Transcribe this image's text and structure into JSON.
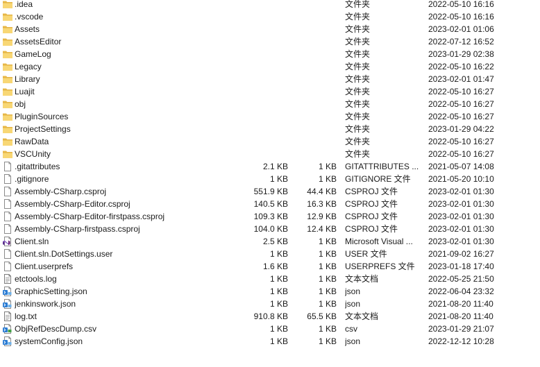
{
  "files": [
    {
      "name": ".idea",
      "size": "",
      "compressed": "",
      "type": "文件夹",
      "date": "2022-05-10 16:16",
      "icon": "folder-icon"
    },
    {
      "name": ".vscode",
      "size": "",
      "compressed": "",
      "type": "文件夹",
      "date": "2022-05-10 16:16",
      "icon": "folder-icon"
    },
    {
      "name": "Assets",
      "size": "",
      "compressed": "",
      "type": "文件夹",
      "date": "2023-02-01 01:06",
      "icon": "folder-icon"
    },
    {
      "name": "AssetsEditor",
      "size": "",
      "compressed": "",
      "type": "文件夹",
      "date": "2022-07-12 16:52",
      "icon": "folder-icon"
    },
    {
      "name": "GameLog",
      "size": "",
      "compressed": "",
      "type": "文件夹",
      "date": "2023-01-29 02:38",
      "icon": "folder-icon"
    },
    {
      "name": "Legacy",
      "size": "",
      "compressed": "",
      "type": "文件夹",
      "date": "2022-05-10 16:22",
      "icon": "folder-icon"
    },
    {
      "name": "Library",
      "size": "",
      "compressed": "",
      "type": "文件夹",
      "date": "2023-02-01 01:47",
      "icon": "folder-icon"
    },
    {
      "name": "Luajit",
      "size": "",
      "compressed": "",
      "type": "文件夹",
      "date": "2022-05-10 16:27",
      "icon": "folder-icon"
    },
    {
      "name": "obj",
      "size": "",
      "compressed": "",
      "type": "文件夹",
      "date": "2022-05-10 16:27",
      "icon": "folder-icon"
    },
    {
      "name": "PluginSources",
      "size": "",
      "compressed": "",
      "type": "文件夹",
      "date": "2022-05-10 16:27",
      "icon": "folder-icon"
    },
    {
      "name": "ProjectSettings",
      "size": "",
      "compressed": "",
      "type": "文件夹",
      "date": "2023-01-29 04:22",
      "icon": "folder-icon"
    },
    {
      "name": "RawData",
      "size": "",
      "compressed": "",
      "type": "文件夹",
      "date": "2022-05-10 16:27",
      "icon": "folder-icon"
    },
    {
      "name": "VSCUnity",
      "size": "",
      "compressed": "",
      "type": "文件夹",
      "date": "2022-05-10 16:27",
      "icon": "folder-icon"
    },
    {
      "name": ".gitattributes",
      "size": "2.1 KB",
      "compressed": "1 KB",
      "type": "GITATTRIBUTES ...",
      "date": "2021-05-07 14:08",
      "icon": "file-icon"
    },
    {
      "name": ".gitignore",
      "size": "1 KB",
      "compressed": "1 KB",
      "type": "GITIGNORE 文件",
      "date": "2021-05-20 10:10",
      "icon": "file-icon"
    },
    {
      "name": "Assembly-CSharp.csproj",
      "size": "551.9 KB",
      "compressed": "44.4 KB",
      "type": "CSPROJ 文件",
      "date": "2023-02-01 01:30",
      "icon": "file-icon"
    },
    {
      "name": "Assembly-CSharp-Editor.csproj",
      "size": "140.5 KB",
      "compressed": "16.3 KB",
      "type": "CSPROJ 文件",
      "date": "2023-02-01 01:30",
      "icon": "file-icon"
    },
    {
      "name": "Assembly-CSharp-Editor-firstpass.csproj",
      "size": "109.3 KB",
      "compressed": "12.9 KB",
      "type": "CSPROJ 文件",
      "date": "2023-02-01 01:30",
      "icon": "file-icon"
    },
    {
      "name": "Assembly-CSharp-firstpass.csproj",
      "size": "104.0 KB",
      "compressed": "12.4 KB",
      "type": "CSPROJ 文件",
      "date": "2023-02-01 01:30",
      "icon": "file-icon"
    },
    {
      "name": "Client.sln",
      "size": "2.5 KB",
      "compressed": "1 KB",
      "type": "Microsoft Visual ...",
      "date": "2023-02-01 01:30",
      "icon": "visual-studio-icon"
    },
    {
      "name": "Client.sln.DotSettings.user",
      "size": "1 KB",
      "compressed": "1 KB",
      "type": "USER 文件",
      "date": "2021-09-02 16:27",
      "icon": "file-icon"
    },
    {
      "name": "Client.userprefs",
      "size": "1.6 KB",
      "compressed": "1 KB",
      "type": "USERPREFS 文件",
      "date": "2023-01-18 17:40",
      "icon": "file-icon"
    },
    {
      "name": "etctools.log",
      "size": "1 KB",
      "compressed": "1 KB",
      "type": "文本文档",
      "date": "2022-05-25 21:50",
      "icon": "text-file-icon"
    },
    {
      "name": "GraphicSetting.json",
      "size": "1 KB",
      "compressed": "1 KB",
      "type": "json",
      "date": "2022-06-04 23:32",
      "icon": "json-file-icon"
    },
    {
      "name": "jenkinswork.json",
      "size": "1 KB",
      "compressed": "1 KB",
      "type": "json",
      "date": "2021-08-20 11:40",
      "icon": "json-file-icon"
    },
    {
      "name": "log.txt",
      "size": "910.8 KB",
      "compressed": "65.5 KB",
      "type": "文本文档",
      "date": "2021-08-20 11:40",
      "icon": "text-file-icon"
    },
    {
      "name": "ObjRefDescDump.csv",
      "size": "1 KB",
      "compressed": "1 KB",
      "type": "csv",
      "date": "2023-01-29 21:07",
      "icon": "csv-file-icon"
    },
    {
      "name": "systemConfig.json",
      "size": "1 KB",
      "compressed": "1 KB",
      "type": "json",
      "date": "2022-12-12 10:28",
      "icon": "json-file-icon"
    }
  ]
}
